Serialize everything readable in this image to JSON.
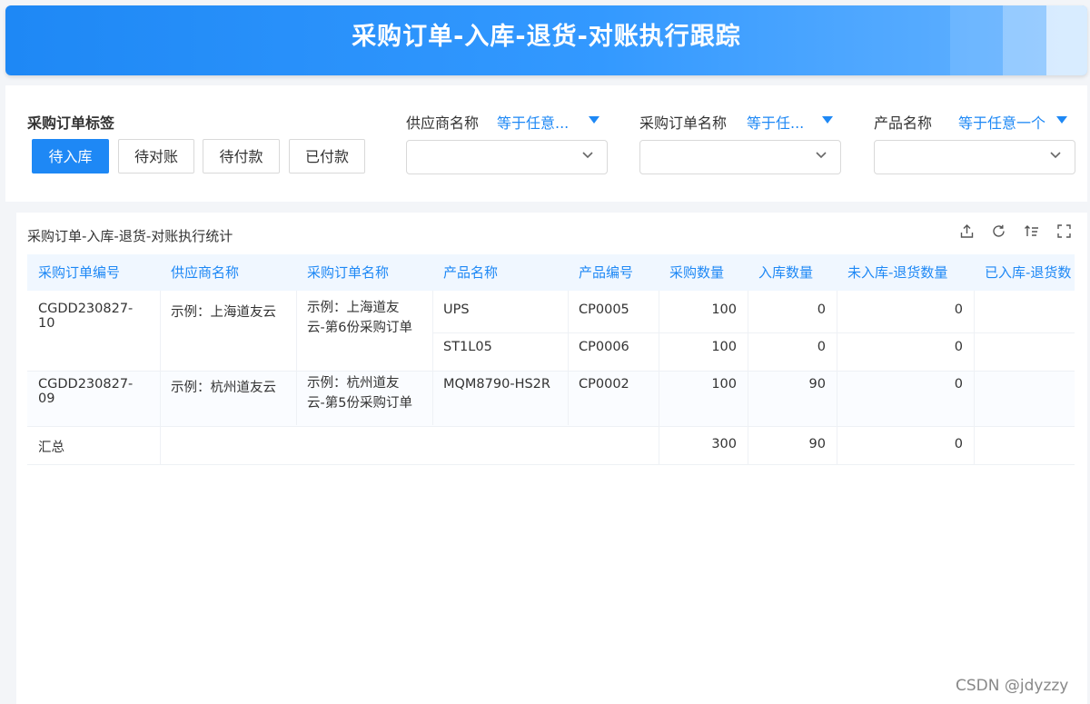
{
  "header": {
    "title": "采购订单-入库-退货-对账执行跟踪"
  },
  "filters": {
    "tag_title": "采购订单标签",
    "tags": [
      "待入库",
      "待对账",
      "待付款",
      "已付款"
    ],
    "active_tag": "待入库",
    "supplier": {
      "label": "供应商名称",
      "operator": "等于任意..."
    },
    "order_name": {
      "label": "采购订单名称",
      "operator": "等于任..."
    },
    "product": {
      "label": "产品名称",
      "operator": "等于任意一个"
    }
  },
  "table": {
    "title": "采购订单-入库-退货-对账执行统计",
    "toolbar_icons": [
      "export-icon",
      "refresh-icon",
      "sort-icon",
      "fullscreen-icon"
    ],
    "columns": [
      "采购订单编号",
      "供应商名称",
      "采购订单名称",
      "产品名称",
      "产品编号",
      "采购数量",
      "入库数量",
      "未入库-退货数量",
      "已入库-退货数"
    ],
    "orders": [
      {
        "order_no": "CGDD230827-10",
        "supplier": "示例：上海道友云",
        "order_name_line1": "示例：上海道友",
        "order_name_line2": "云-第6份采购订单",
        "items": [
          {
            "product": "UPS",
            "code": "CP0005",
            "qty": "100",
            "in_qty": "0",
            "not_in_return": "0"
          },
          {
            "product": "ST1L05",
            "code": "CP0006",
            "qty": "100",
            "in_qty": "0",
            "not_in_return": "0"
          }
        ]
      },
      {
        "order_no": "CGDD230827-09",
        "supplier": "示例：杭州道友云",
        "order_name_line1": "示例：杭州道友",
        "order_name_line2": "云-第5份采购订单",
        "items": [
          {
            "product": "MQM8790-HS2R",
            "code": "CP0002",
            "qty": "100",
            "in_qty": "90",
            "not_in_return": "0"
          }
        ]
      }
    ],
    "summary": {
      "label": "汇总",
      "qty": "300",
      "in_qty": "90",
      "not_in_return": "0"
    }
  },
  "watermark": "CSDN @jdyzzy"
}
